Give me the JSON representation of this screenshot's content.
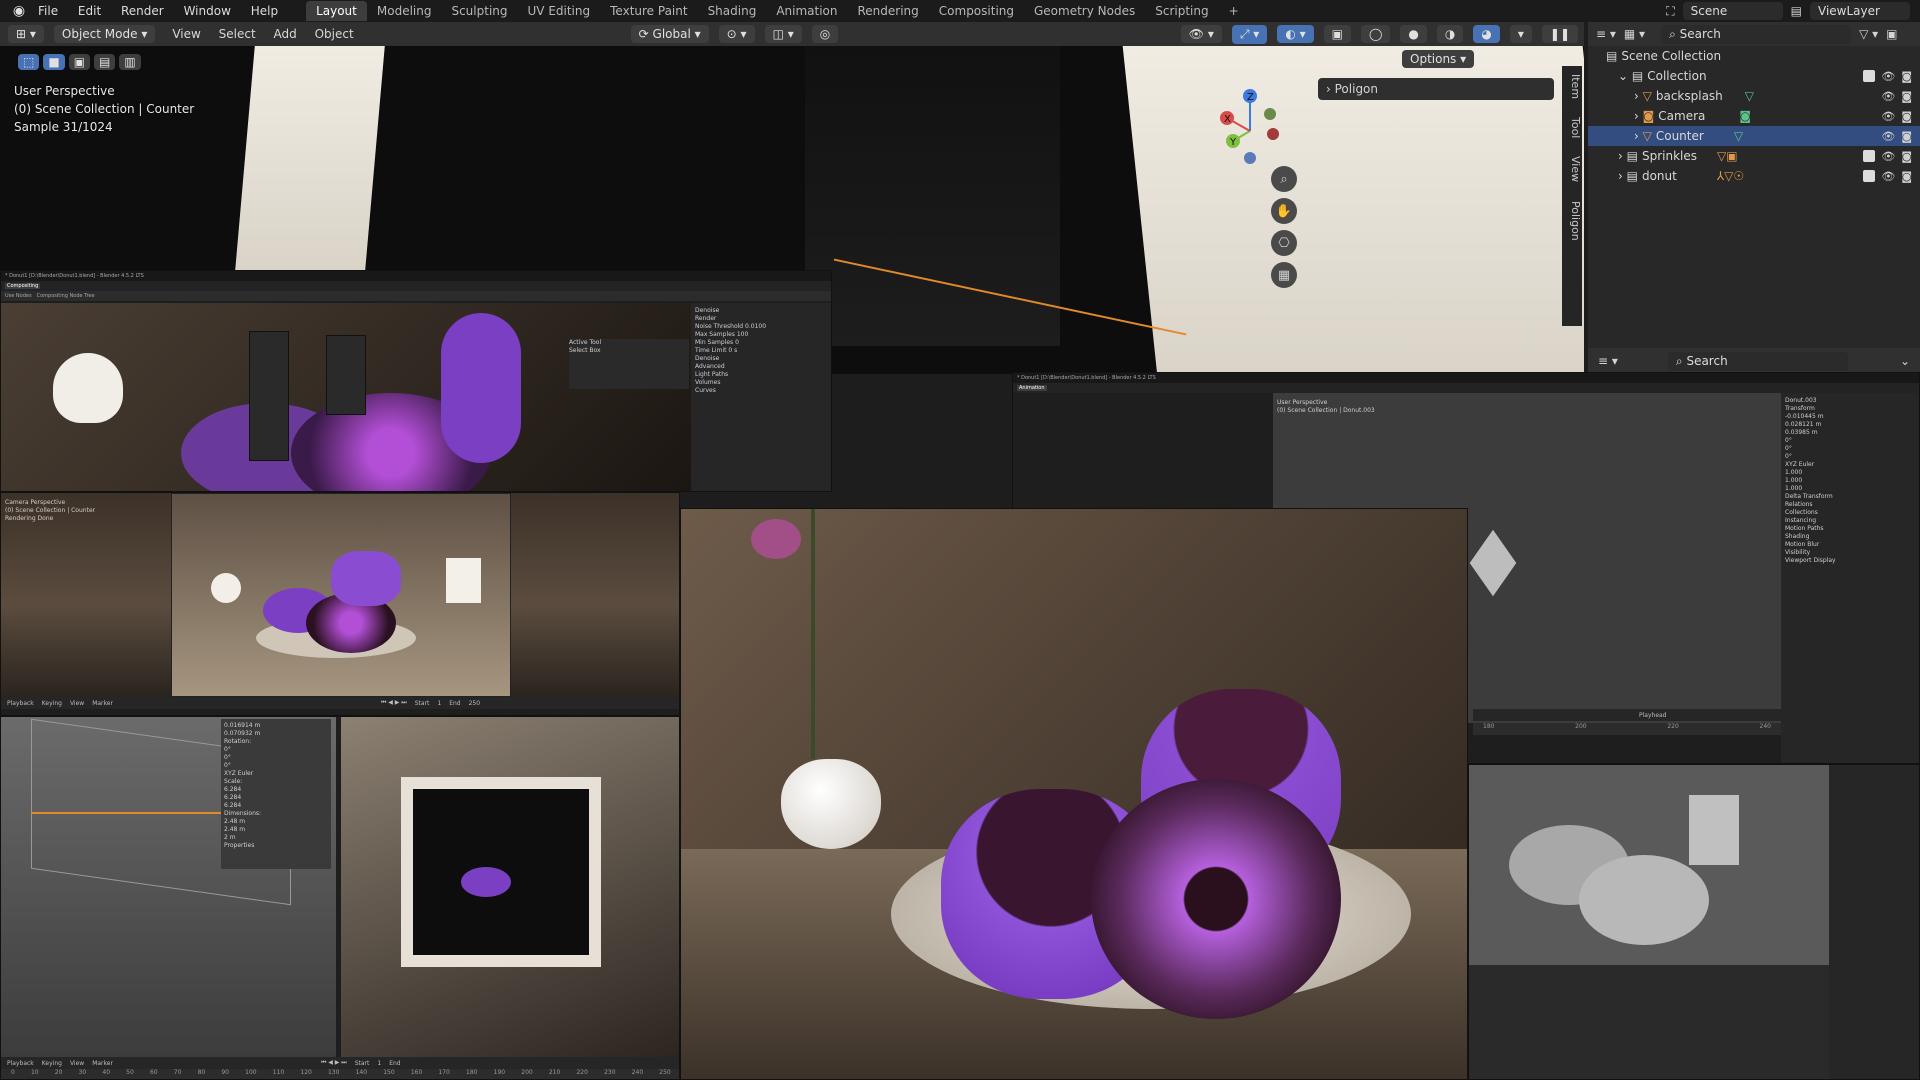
{
  "app": {
    "menu": [
      "File",
      "Edit",
      "Render",
      "Window",
      "Help"
    ],
    "workspaces": [
      "Layout",
      "Modeling",
      "Sculpting",
      "UV Editing",
      "Texture Paint",
      "Shading",
      "Animation",
      "Rendering",
      "Compositing",
      "Geometry Nodes",
      "Scripting"
    ],
    "active_workspace": "Layout",
    "add_tab": "+",
    "scene": "Scene",
    "view_layer": "ViewLayer"
  },
  "viewport_header": {
    "mode": "Object Mode",
    "menus": [
      "View",
      "Select",
      "Add",
      "Object"
    ],
    "orientation": "Global",
    "options": "Options"
  },
  "viewport": {
    "overlay_lines": [
      "User Perspective",
      "(0) Scene Collection | Counter",
      "Sample 31/1024"
    ],
    "sidebar_panel": "Poligon",
    "side_tabs": [
      "Item",
      "Tool",
      "View",
      "Poligon"
    ],
    "gizmo": {
      "z": "Z",
      "y": "Y",
      "x": "X"
    }
  },
  "outliner": {
    "search_placeholder": "Search",
    "scene_collection": "Scene Collection",
    "rows": [
      {
        "name": "Collection",
        "indent": 1
      },
      {
        "name": "backsplash",
        "indent": 2
      },
      {
        "name": "Camera",
        "indent": 2
      },
      {
        "name": "Counter",
        "indent": 2,
        "selected": true
      },
      {
        "name": "Sprinkles",
        "indent": 1
      },
      {
        "name": "donut",
        "indent": 1
      }
    ],
    "properties_search_placeholder": "Search"
  },
  "screens": {
    "compositor": {
      "title": "* Donut1 [D:\\Blender\\Donut1.blend] - Blender 4.5.2 LTS",
      "workspace": "Compositing",
      "node_tree": "Compositing Node Tree",
      "use_nodes": "Use Nodes",
      "render_settings": [
        "Denoise",
        "Render",
        "Noise Threshold",
        "Max Samples",
        "Min Samples",
        "Time Limit",
        "Denoise",
        "Advanced",
        "Light Paths",
        "Volumes",
        "Curves"
      ],
      "noise_threshold": "0.0100",
      "max_samples": "100",
      "min_samples": "0",
      "time_limit": "0 s",
      "active_tool": "Active Tool",
      "select_box": "Select Box"
    },
    "camera_view": {
      "overlay_lines": [
        "Camera Perspective",
        "(0) Scene Collection | Counter",
        "Rendering Done"
      ],
      "timeline": [
        "Playback",
        "Keying",
        "View",
        "Marker"
      ],
      "start": "Start",
      "start_val": "1",
      "end": "End",
      "end_val": "250"
    },
    "animation": {
      "title": "* Donut1 [D:\\Blender\\Donut1.blend] - Blender 4.5.2 LTS",
      "workspace": "Animation",
      "overlay_lines": [
        "User Perspective",
        "(0) Scene Collection | Donut.003"
      ],
      "object": "Donut.003",
      "transform": "Transform",
      "location": {
        "x": "-0.010445 m",
        "y": "0.028121 m",
        "z": "0.03985 m"
      },
      "rotation": {
        "x": "0°",
        "y": "0°",
        "z": "0°"
      },
      "mode": "XYZ Euler",
      "scale": {
        "x": "1.000",
        "y": "1.000",
        "z": "1.000"
      },
      "sections": [
        "Delta Transform",
        "Relations",
        "Collections",
        "Instancing",
        "Motion Paths",
        "Shading",
        "Motion Blur",
        "Visibility",
        "Viewport Display"
      ],
      "ruler": [
        "180",
        "200",
        "220",
        "240"
      ],
      "playhead": "Playhead"
    },
    "modeling": {
      "rotation_label": "Rotation:",
      "loc_vals": [
        "0.016914 m",
        "0.070932 m"
      ],
      "rot_vals": [
        "0°",
        "0°",
        "0°"
      ],
      "mode": "XYZ Euler",
      "scale_label": "Scale:",
      "scale_vals": [
        "6.284",
        "6.284",
        "6.284"
      ],
      "dim_label": "Dimensions:",
      "dim_vals": [
        "2.48 m",
        "2.48 m",
        "2 m"
      ],
      "properties": "Properties",
      "timeline": [
        "Playback",
        "Keying",
        "View",
        "Marker"
      ],
      "ruler": [
        "0",
        "10",
        "20",
        "30",
        "40",
        "50",
        "60",
        "70",
        "80",
        "90",
        "100",
        "110",
        "120",
        "130",
        "140",
        "150",
        "160",
        "170",
        "180",
        "190",
        "200",
        "210",
        "220",
        "230",
        "240",
        "250"
      ],
      "start": "Start",
      "start_val": "1",
      "end": "End"
    }
  },
  "colors": {
    "accent": "#4772b3",
    "selection": "#334d80",
    "orange": "#e09a4a",
    "green": "#5cc28b",
    "purple": "#7b3fc4"
  }
}
